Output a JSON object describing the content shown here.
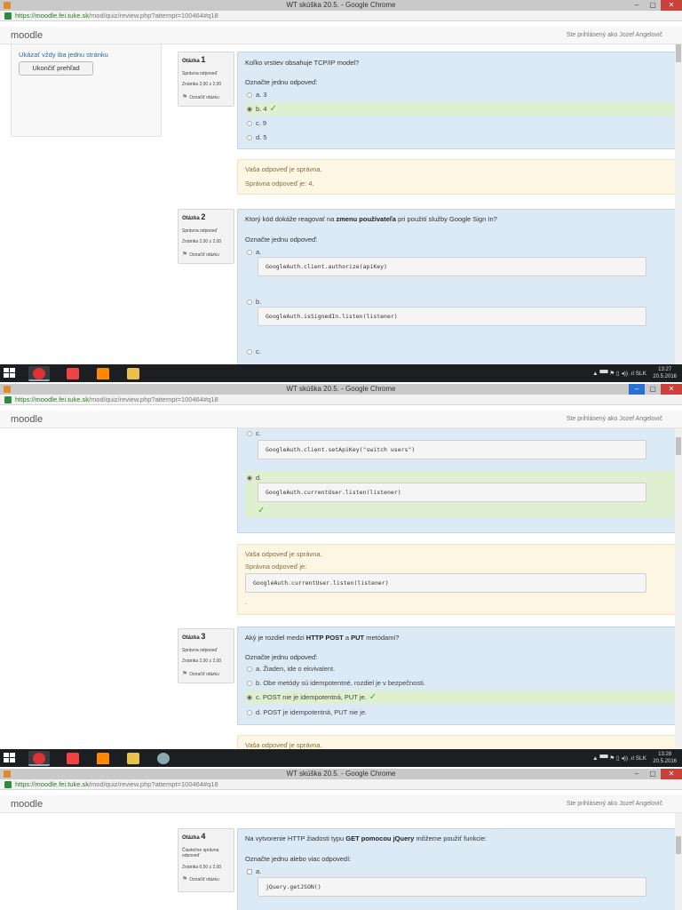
{
  "browser": {
    "window_title": "WT skúška 20.5. - Google Chrome",
    "url_host": "https://moodle.fei.tuke.sk",
    "url_path": "/mod/quiz/review.php?attempt=100464#q18",
    "minimize": "–",
    "maximize": "▢",
    "close": "✕"
  },
  "moodle": {
    "brand": "moodle",
    "login_info": "Ste prihlásený ako Jozef Angelovič"
  },
  "quiz_nav": {
    "show_one_page": "Ukázať vždy iba jednu stránku",
    "finish_review": "Ukončiť prehľad"
  },
  "q1": {
    "label": "Otázka",
    "number": "1",
    "state": "Správna odpoveď",
    "grade": "Známka 2,00 z 2,00",
    "flag": "Označiť otázku",
    "text": "Koľko vrstiev obsahuje TCP/IP model?",
    "prompt": "Označte jednu odpoveď:",
    "options": [
      "a. 3",
      "b. 4",
      "c. 9",
      "d. 5"
    ],
    "feedback": "Vaša odpoveď je správna.",
    "right_answer": "Správna odpoveď je: 4."
  },
  "q2": {
    "label": "Otázka",
    "number": "2",
    "state": "Správna odpoveď",
    "grade": "Známka 2,00 z 2,00",
    "flag": "Označiť otázku",
    "text_before": "Ktorý kód dokáže reagovať na",
    "text_bold": "zmenu používateľa",
    "text_after": "pri použití služby Google Sign In?",
    "prompt": "Označte jednu odpoveď:",
    "options": [
      {
        "letter": "a.",
        "code": "GoogleAuth.client.authorize(apiKey)"
      },
      {
        "letter": "b.",
        "code": "GoogleAuth.isSignedIn.listen(listener)"
      },
      {
        "letter": "c.",
        "code": "GoogleAuth.client.setApiKey(\"switch users\")"
      },
      {
        "letter": "d.",
        "code": "GoogleAuth.currentUser.listen(listener)"
      }
    ],
    "feedback": "Vaša odpoveď je správna.",
    "right_answer": "Správna odpoveď je:",
    "right_code": "GoogleAuth.currentUser.listen(listener)",
    "trailing": "."
  },
  "q3": {
    "label": "Otázka",
    "number": "3",
    "state": "Správna odpoveď",
    "grade": "Známka 2,00 z 2,00",
    "flag": "Označiť otázku",
    "text_before": "Aký je rozdiel medzi",
    "text_bold1": "HTTP POST",
    "text_mid": "a",
    "text_bold2": "PUT",
    "text_after": "metódami?",
    "prompt": "Označte jednu odpoveď:",
    "options": [
      "a. Žiaden, ide o ekvivalent.",
      "b. Obe metódy sú idempotentné, rozdiel je v bezpečnosti.",
      "c. POST nie je idempotentná, PUT je.",
      "d. POST je idempotentná, PUT nie je."
    ],
    "feedback": "Vaša odpoveď je správna."
  },
  "q4": {
    "label": "Otázka",
    "number": "4",
    "state": "Čiastočne správna odpoveď",
    "grade": "Známka 0,50 z 2,00",
    "flag": "Označiť otázku",
    "text_before": "Na vytvorenie HTTP žiadosti typu",
    "text_bold": "GET pomocou jQuery",
    "text_after": "môžeme použiť funkcie:",
    "prompt": "Označte jednu alebo viac odpovedí:",
    "options": [
      {
        "letter": "a.",
        "code": "jQuery.getJSON()"
      }
    ]
  },
  "taskbar": {
    "tray": "▲ ▀▀ ⚑ ▯ ◂)) .ıl SLK",
    "clock1_time": "13:27",
    "clock1_date": "20.5.2016",
    "clock2_time": "13:28",
    "clock2_date": "20.5.2016"
  }
}
